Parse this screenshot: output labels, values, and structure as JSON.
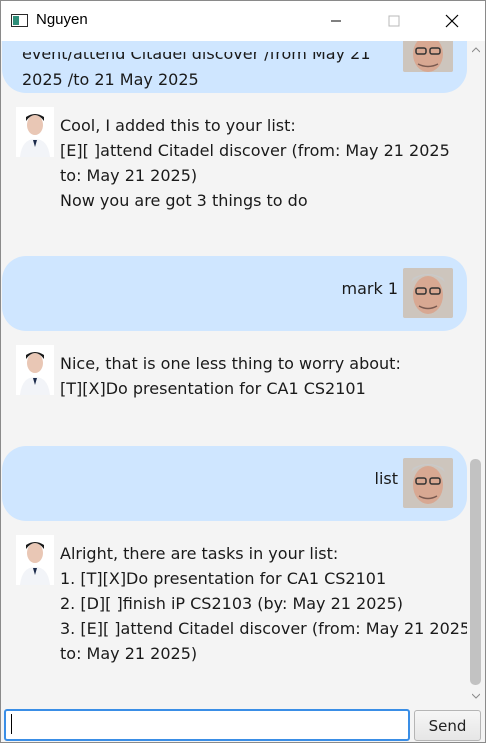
{
  "window": {
    "title": "Nguyen",
    "controls": [
      "minimize-icon",
      "maximize-icon",
      "close-icon"
    ]
  },
  "chat": {
    "messages": [
      {
        "sender": "user",
        "lines": [
          "event/attend Citadel discover /from May 21",
          "2025 /to 21 May 2025"
        ]
      },
      {
        "sender": "bot",
        "lines": [
          "Cool, I added this to your list:",
          "[E][ ]attend Citadel discover (from: May 21 2025",
          "to: May 21 2025)",
          "Now you are got 3 things to do"
        ]
      },
      {
        "sender": "user",
        "lines": [
          "mark 1"
        ]
      },
      {
        "sender": "bot",
        "lines": [
          "Nice, that is one less thing to worry about:",
          "[T][X]Do presentation for CA1 CS2101"
        ]
      },
      {
        "sender": "user",
        "lines": [
          "list"
        ]
      },
      {
        "sender": "bot",
        "lines": [
          "Alright, there are tasks in your list:",
          "1. [T][X]Do presentation for CA1 CS2101",
          "2. [D][ ]finish iP CS2103 (by: May 21 2025)",
          "3. [E][ ]attend Citadel discover (from: May 21 2025",
          "to: May 21 2025)"
        ]
      }
    ]
  },
  "input": {
    "value": "",
    "send_label": "Send"
  },
  "colors": {
    "user_bubble": "#cfe6ff",
    "input_focus": "#3a8ee6"
  }
}
